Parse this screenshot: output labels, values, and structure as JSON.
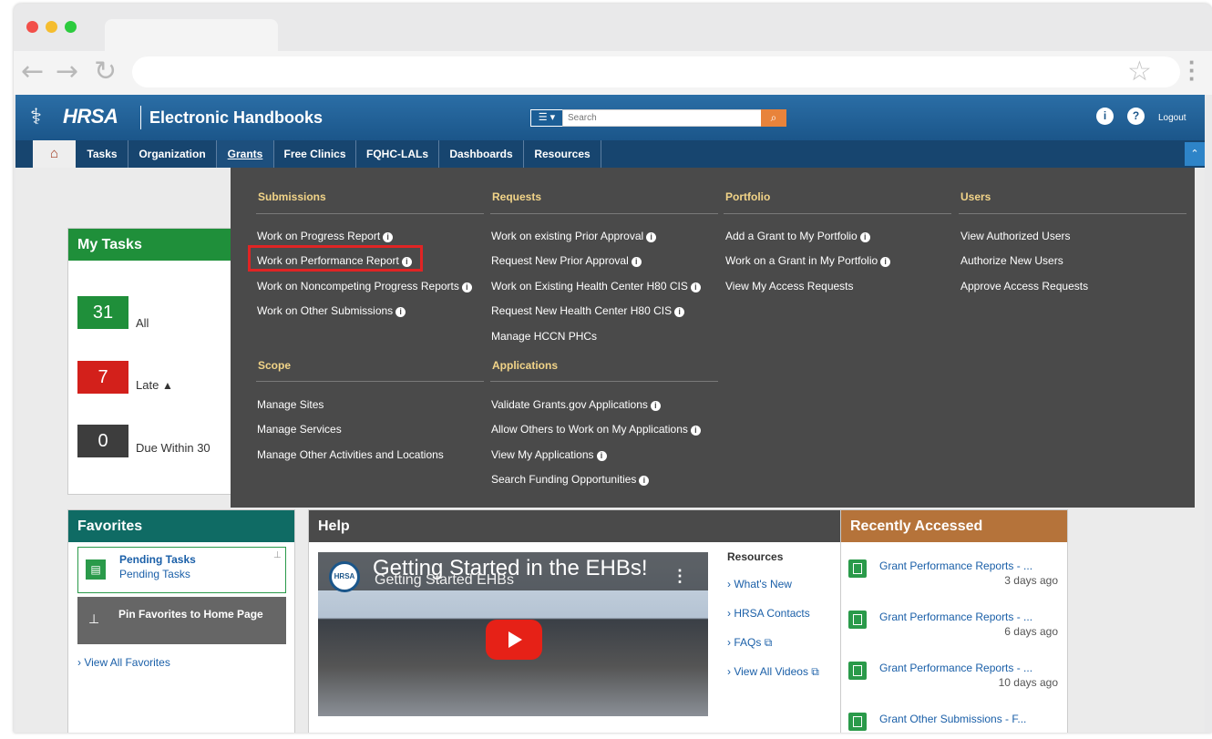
{
  "header": {
    "logo_text": "HRSA",
    "title": "Electronic Handbooks",
    "search_placeholder": "Search",
    "logout": "Logout",
    "user_icon": "user-circle-icon",
    "help_icon": "question-circle-icon"
  },
  "nav": {
    "items": [
      {
        "label": "Tasks"
      },
      {
        "label": "Organization"
      },
      {
        "label": "Grants",
        "active": true
      },
      {
        "label": "Free Clinics"
      },
      {
        "label": "FQHC-LALs"
      },
      {
        "label": "Dashboards"
      },
      {
        "label": "Resources"
      }
    ]
  },
  "dropdown": {
    "submissions": {
      "heading": "Submissions",
      "links": [
        "Work on Progress Report",
        "Work on Performance Report",
        "Work on Noncompeting Progress Reports",
        "Work on Other Submissions"
      ]
    },
    "requests": {
      "heading": "Requests",
      "links": [
        "Work on existing Prior Approval",
        "Request New Prior Approval",
        "Work on Existing Health Center H80 CIS",
        "Request New Health Center H80 CIS",
        "Manage HCCN PHCs"
      ]
    },
    "portfolio": {
      "heading": "Portfolio",
      "links": [
        "Add a Grant to My Portfolio",
        "Work on a Grant in My Portfolio",
        "View My Access Requests"
      ]
    },
    "users": {
      "heading": "Users",
      "links": [
        "View Authorized Users",
        "Authorize New Users",
        "Approve Access Requests"
      ]
    },
    "scope": {
      "heading": "Scope",
      "links": [
        "Manage Sites",
        "Manage Services",
        "Manage Other Activities and Locations"
      ]
    },
    "applications": {
      "heading": "Applications",
      "links": [
        "Validate Grants.gov Applications",
        "Allow Others to Work on My Applications",
        "View My Applications",
        "Search Funding Opportunities"
      ]
    }
  },
  "my_tasks": {
    "title": "My Tasks",
    "counts": [
      {
        "value": "31",
        "label": "All",
        "color": "#1f8f3a"
      },
      {
        "value": "7",
        "label": "Late",
        "color": "#d3201b"
      },
      {
        "value": "0",
        "label": "Due Within 30",
        "color": "#3d3d3d"
      }
    ]
  },
  "favorites": {
    "title": "Favorites",
    "pending_title": "Pending Tasks",
    "pending_sub": "Pending Tasks",
    "pin_label": "Pin Favorites to Home Page",
    "view_all": "› View All Favorites"
  },
  "help": {
    "title": "Help",
    "video_title": "Getting Started in the EHBs!",
    "video_channel_title": "Getting Started EHBs",
    "resources_heading": "Resources",
    "resources": [
      "› What's New",
      "› HRSA Contacts",
      "› FAQs",
      "› View All Videos"
    ]
  },
  "recent": {
    "title": "Recently Accessed",
    "items": [
      {
        "title": "Grant Performance Reports - ...",
        "time": "3 days ago"
      },
      {
        "title": "Grant Performance Reports - ...",
        "time": "6 days ago"
      },
      {
        "title": "Grant Performance Reports - ...",
        "time": "10 days ago"
      },
      {
        "title": "Grant Other Submissions - F...",
        "time": ""
      }
    ]
  },
  "colors": {
    "header_blue": "#1b568a",
    "nav_dark": "#17456f",
    "green": "#1f8f3a",
    "teal": "#0f6b64",
    "brown": "#b5733a",
    "dropdown_bg": "#4a4a4a",
    "highlight": "#e02424"
  }
}
